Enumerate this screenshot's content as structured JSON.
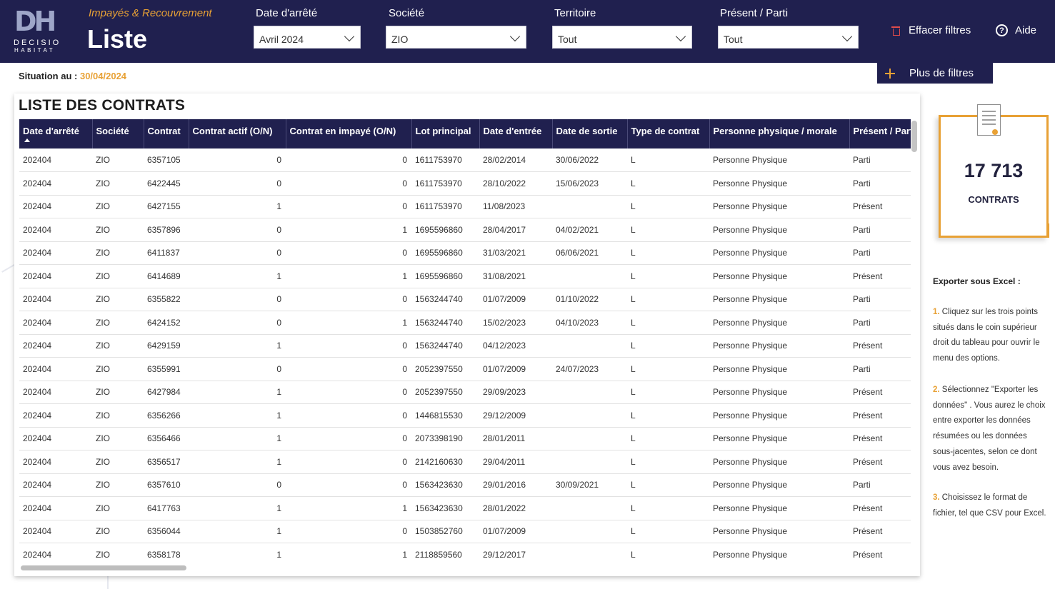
{
  "header": {
    "logo_letters": "DH",
    "logo_line1": "DECISIO",
    "logo_line2": "HABITAT",
    "subtitle": "Impayés & Recouvrement",
    "title": "Liste",
    "filters": [
      {
        "label": "Date d'arrêté",
        "value": "Avril 2024"
      },
      {
        "label": "Société",
        "value": "ZIO"
      },
      {
        "label": "Territoire",
        "value": "Tout"
      },
      {
        "label": "Présent / Parti",
        "value": "Tout"
      }
    ],
    "clear_filters": "Effacer filtres",
    "help": "Aide",
    "help_glyph": "?",
    "more_filters": "Plus de filtres"
  },
  "situation": {
    "label": "Situation au :",
    "date": "30/04/2024"
  },
  "table": {
    "title": "LISTE DES CONTRATS",
    "columns": [
      "Date d'arrêté",
      "Société",
      "Contrat",
      "Contrat actif (O/N)",
      "Contrat en impayé (O/N)",
      "Lot principal",
      "Date d'entrée",
      "Date de sortie",
      "Type de contrat",
      "Personne physique / morale",
      "Présent / Parti"
    ],
    "rows": [
      [
        "202404",
        "ZIO",
        "6357105",
        "0",
        "0",
        "1611753970",
        "28/02/2014",
        "30/06/2022",
        "L",
        "Personne Physique",
        "Parti"
      ],
      [
        "202404",
        "ZIO",
        "6422445",
        "0",
        "0",
        "1611753970",
        "28/10/2022",
        "15/06/2023",
        "L",
        "Personne Physique",
        "Parti"
      ],
      [
        "202404",
        "ZIO",
        "6427155",
        "1",
        "0",
        "1611753970",
        "11/08/2023",
        "",
        "L",
        "Personne Physique",
        "Présent"
      ],
      [
        "202404",
        "ZIO",
        "6357896",
        "0",
        "1",
        "1695596860",
        "28/04/2017",
        "04/02/2021",
        "L",
        "Personne Physique",
        "Parti"
      ],
      [
        "202404",
        "ZIO",
        "6411837",
        "0",
        "0",
        "1695596860",
        "31/03/2021",
        "06/06/2021",
        "L",
        "Personne Physique",
        "Parti"
      ],
      [
        "202404",
        "ZIO",
        "6414689",
        "1",
        "1",
        "1695596860",
        "31/08/2021",
        "",
        "L",
        "Personne Physique",
        "Présent"
      ],
      [
        "202404",
        "ZIO",
        "6355822",
        "0",
        "0",
        "1563244740",
        "01/07/2009",
        "01/10/2022",
        "L",
        "Personne Physique",
        "Parti"
      ],
      [
        "202404",
        "ZIO",
        "6424152",
        "0",
        "1",
        "1563244740",
        "15/02/2023",
        "04/10/2023",
        "L",
        "Personne Physique",
        "Parti"
      ],
      [
        "202404",
        "ZIO",
        "6429159",
        "1",
        "0",
        "1563244740",
        "04/12/2023",
        "",
        "L",
        "Personne Physique",
        "Présent"
      ],
      [
        "202404",
        "ZIO",
        "6355991",
        "0",
        "0",
        "2052397550",
        "01/07/2009",
        "24/07/2023",
        "L",
        "Personne Physique",
        "Parti"
      ],
      [
        "202404",
        "ZIO",
        "6427984",
        "1",
        "0",
        "2052397550",
        "29/09/2023",
        "",
        "L",
        "Personne Physique",
        "Présent"
      ],
      [
        "202404",
        "ZIO",
        "6356266",
        "1",
        "0",
        "1446815530",
        "29/12/2009",
        "",
        "L",
        "Personne Physique",
        "Présent"
      ],
      [
        "202404",
        "ZIO",
        "6356466",
        "1",
        "0",
        "2073398190",
        "28/01/2011",
        "",
        "L",
        "Personne Physique",
        "Présent"
      ],
      [
        "202404",
        "ZIO",
        "6356517",
        "1",
        "0",
        "2142160630",
        "29/04/2011",
        "",
        "L",
        "Personne Physique",
        "Présent"
      ],
      [
        "202404",
        "ZIO",
        "6357610",
        "0",
        "0",
        "1563423630",
        "29/01/2016",
        "30/09/2021",
        "L",
        "Personne Physique",
        "Parti"
      ],
      [
        "202404",
        "ZIO",
        "6417763",
        "1",
        "1",
        "1563423630",
        "28/01/2022",
        "",
        "L",
        "Personne Physique",
        "Présent"
      ],
      [
        "202404",
        "ZIO",
        "6356044",
        "1",
        "0",
        "1503852760",
        "01/07/2009",
        "",
        "L",
        "Personne Physique",
        "Présent"
      ],
      [
        "202404",
        "ZIO",
        "6358178",
        "1",
        "1",
        "2118859560",
        "29/12/2017",
        "",
        "L",
        "Personne Physique",
        "Présent"
      ]
    ]
  },
  "kpi": {
    "value": "17 713",
    "label": "CONTRATS"
  },
  "export": {
    "title": "Exporter sous Excel :",
    "steps": [
      {
        "n": "1.",
        "text": "Cliquez sur les trois points situés dans le coin supérieur droit du tableau pour ouvrir le menu des options."
      },
      {
        "n": "2.",
        "text": "Sélectionnez \"Exporter les données\" . Vous aurez le choix entre exporter les données résumées ou les données sous-jacentes, selon ce dont vous avez besoin."
      },
      {
        "n": "3.",
        "text": "Choisissez le format de fichier, tel que CSV pour Excel."
      }
    ]
  },
  "colors": {
    "navy": "#20204f",
    "accent": "#e8a135"
  },
  "icons": [
    "trash-icon",
    "help-icon",
    "plus-icon",
    "chevron-down-icon",
    "document-icon",
    "sort-up-icon"
  ]
}
